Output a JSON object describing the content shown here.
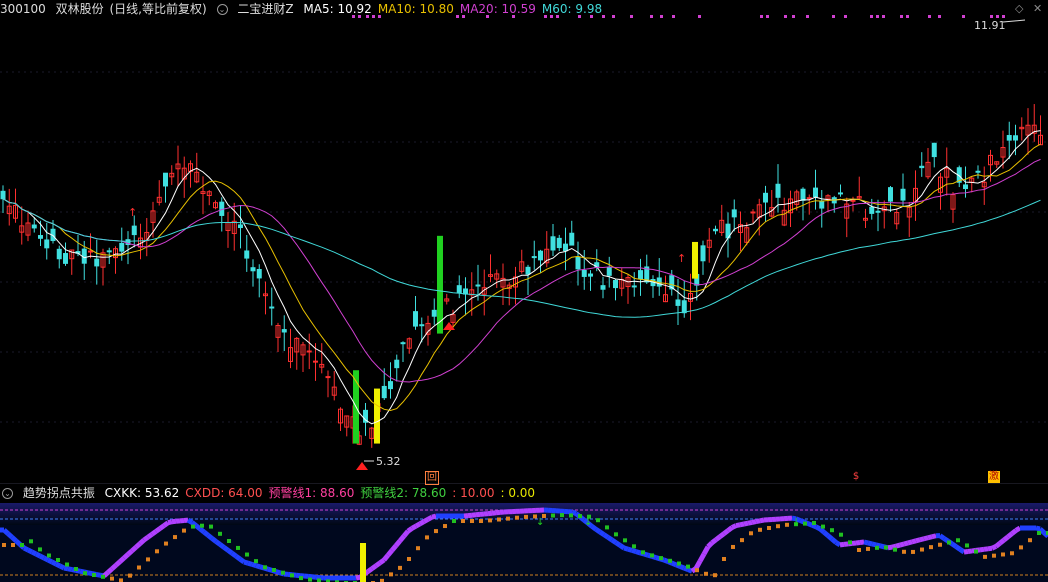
{
  "header": {
    "code": "300100",
    "name": "双林股份",
    "mode": "(日线,等比前复权)",
    "indicator": "二宝进财Z",
    "ma": [
      {
        "label": "MA5: 10.92",
        "color": "#ffffff"
      },
      {
        "label": "MA10: 10.80",
        "color": "#e8c000"
      },
      {
        "label": "MA20: 10.59",
        "color": "#d040d0"
      },
      {
        "label": "M60: 9.98",
        "color": "#40d8d8"
      }
    ]
  },
  "sub_header": {
    "name": "趋势拐点共振",
    "items": [
      {
        "label": "CXKK: 53.62",
        "color": "#ffffff"
      },
      {
        "label": "CXDD: 64.00",
        "color": "#ff5050"
      },
      {
        "label": "预警线1: 88.60",
        "color": "#ff40a0"
      },
      {
        "label": "预警线2: 78.60",
        "color": "#40d040"
      },
      {
        "label": ": 10.00",
        "color": "#ff5050"
      },
      {
        "label": ": 0.00",
        "color": "#e8e800"
      }
    ]
  },
  "annotations": {
    "high_label": "11.91",
    "low_label": "5.32"
  },
  "markers": [
    {
      "name": "review-marker",
      "text": "回",
      "color": "#ff8040"
    },
    {
      "name": "dollar-marker",
      "text": "$",
      "color": "#ff4040"
    },
    {
      "name": "surge-marker",
      "text": "激",
      "color": "#ff8040"
    }
  ],
  "controls": {
    "settings_icon": "diamond-icon",
    "close_icon": "close-icon"
  },
  "chart_data": {
    "type": "candlestick",
    "price_range": [
      5.0,
      12.3
    ],
    "high": 11.91,
    "low": 5.32,
    "moving_averages": {
      "MA5": 10.92,
      "MA10": 10.8,
      "MA20": 10.59,
      "M60": 9.98
    },
    "oscillator": {
      "CXKK": 53.62,
      "CXDD": 64.0,
      "warn1": 88.6,
      "warn2": 78.6
    }
  }
}
